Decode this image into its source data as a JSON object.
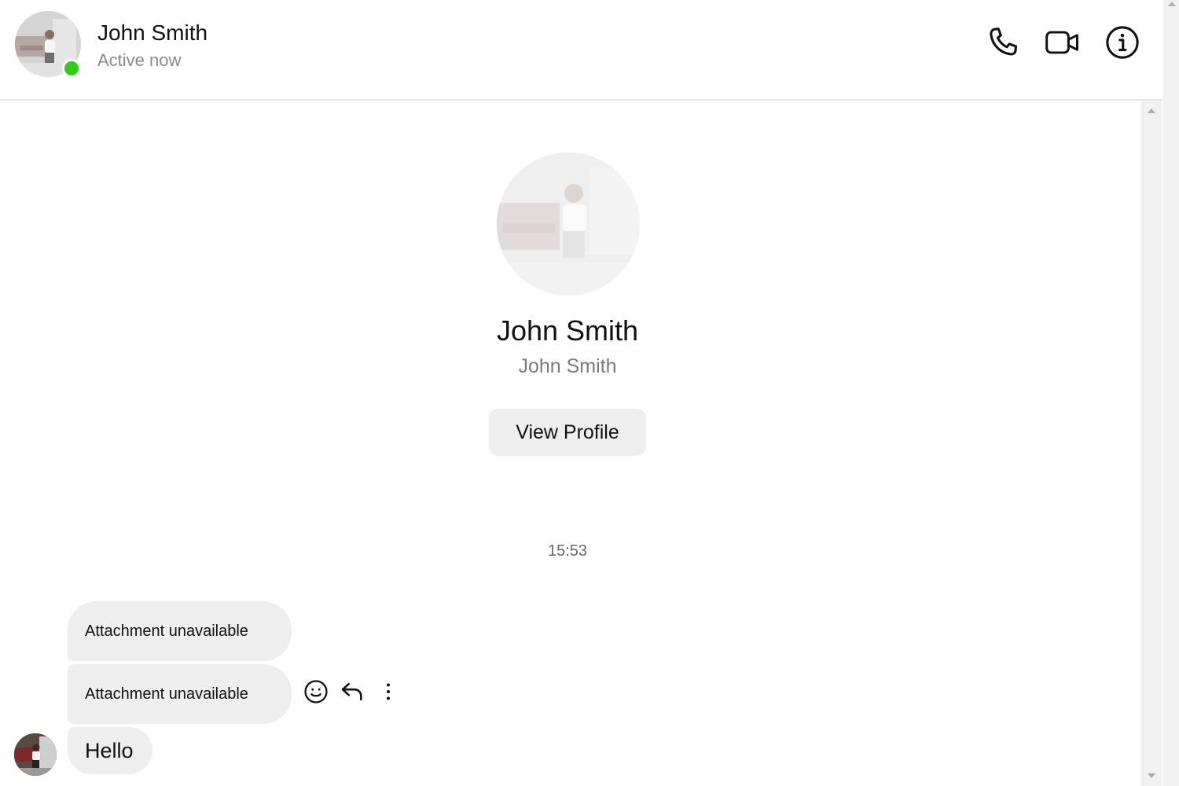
{
  "header": {
    "name": "John Smith",
    "status": "Active now",
    "online_color": "#31cc19",
    "actions": [
      {
        "icon": "phone-icon"
      },
      {
        "icon": "video-icon"
      },
      {
        "icon": "info-icon"
      }
    ]
  },
  "profile": {
    "name": "John Smith",
    "subname": "John Smith",
    "view_profile_label": "View Profile"
  },
  "conversation": {
    "timestamp": "15:53",
    "messages": [
      {
        "text": "Attachment unavailable"
      },
      {
        "text": "Attachment unavailable"
      },
      {
        "text": "Hello"
      }
    ],
    "hover_actions": [
      {
        "icon": "emoji-reaction-icon"
      },
      {
        "icon": "reply-icon"
      },
      {
        "icon": "more-options-icon"
      }
    ]
  }
}
